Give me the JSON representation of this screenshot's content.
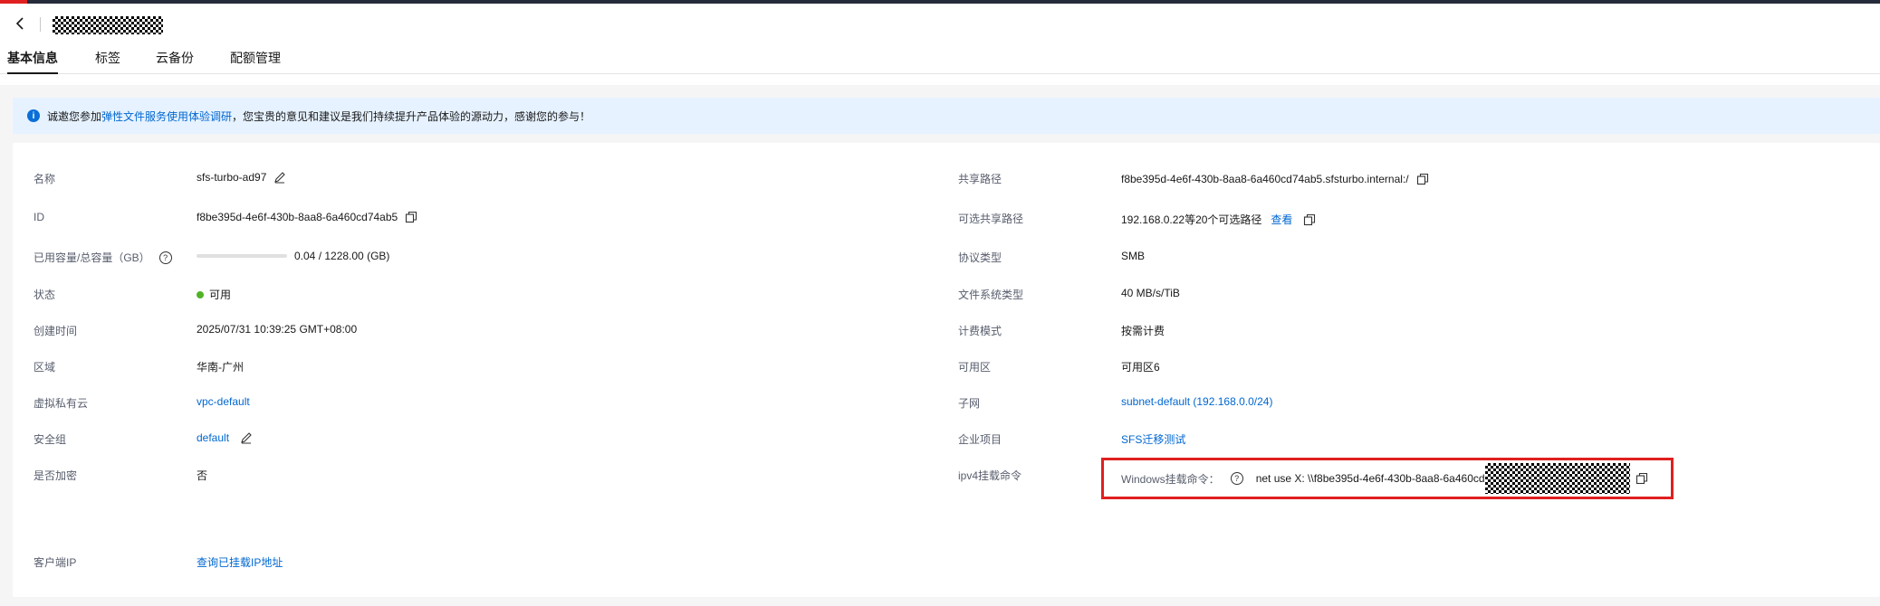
{
  "header": {
    "back_icon": "chevron-left-icon"
  },
  "tabs": [
    {
      "label": "基本信息",
      "active": true
    },
    {
      "label": "标签",
      "active": false
    },
    {
      "label": "云备份",
      "active": false
    },
    {
      "label": "配额管理",
      "active": false
    }
  ],
  "notice": {
    "prefix": "诚邀您参加",
    "link": "弹性文件服务使用体验调研",
    "suffix": "，您宝贵的意见和建议是我们持续提升产品体验的源动力，感谢您的参与！"
  },
  "left": {
    "name_label": "名称",
    "name_value": "sfs-turbo-ad97",
    "id_label": "ID",
    "id_value": "f8be395d-4e6f-430b-8aa8-6a460cd74ab5",
    "capacity_label": "已用容量/总容量（GB）",
    "capacity_value": "0.04 / 1228.00 (GB)",
    "capacity_used_fraction": 3e-05,
    "status_label": "状态",
    "status_value": "可用",
    "created_label": "创建时间",
    "created_value": "2025/07/31 10:39:25 GMT+08:00",
    "region_label": "区域",
    "region_value": "华南-广州",
    "vpc_label": "虚拟私有云",
    "vpc_value": "vpc-default",
    "sg_label": "安全组",
    "sg_value": "default",
    "encrypt_label": "是否加密",
    "encrypt_value": "否",
    "client_ip_label": "客户端IP",
    "client_ip_value": "查询已挂载IP地址"
  },
  "right": {
    "share_path_label": "共享路径",
    "share_path_value": "f8be395d-4e6f-430b-8aa8-6a460cd74ab5.sfsturbo.internal:/",
    "alt_path_label": "可选共享路径",
    "alt_path_value": "192.168.0.22等20个可选路径",
    "alt_path_link": "查看",
    "protocol_label": "协议类型",
    "protocol_value": "SMB",
    "fs_type_label": "文件系统类型",
    "fs_type_value": "40 MB/s/TiB",
    "billing_label": "计费模式",
    "billing_value": "按需计费",
    "az_label": "可用区",
    "az_value": "可用区6",
    "subnet_label": "子网",
    "subnet_value": "subnet-default (192.168.0.0/24)",
    "enterprise_label": "企业项目",
    "enterprise_value": "SFS迁移测试",
    "ipv4_label": "ipv4挂载命令",
    "windows_label": "Windows挂载命令：",
    "windows_cmd": "net use X: \\\\f8be395d-4e6f-430b-8aa8-6a460cd"
  },
  "colors": {
    "link": "#0067d1",
    "status_ok": "#51b226",
    "highlight_border": "#e02020",
    "notice_bg": "#e6f2ff"
  }
}
